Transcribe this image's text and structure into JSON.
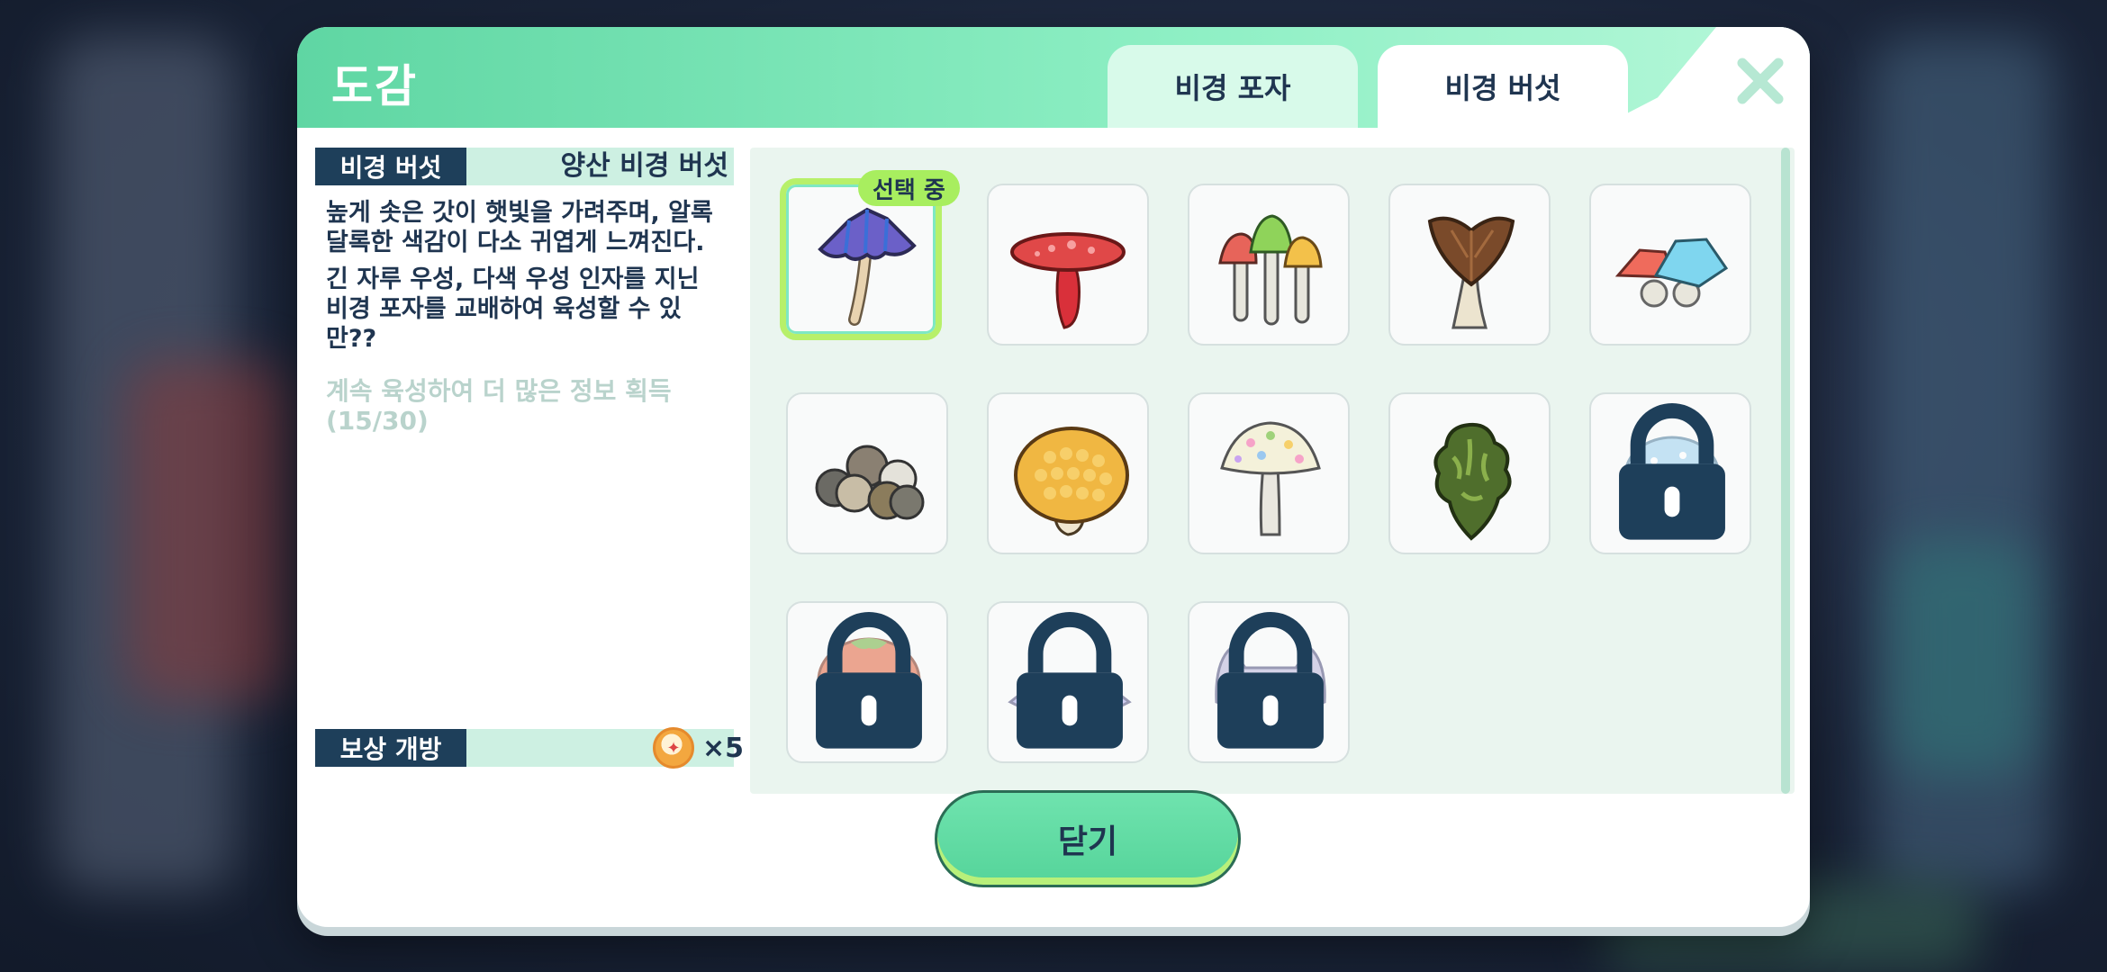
{
  "dialog": {
    "title": "도감",
    "tabs": [
      {
        "label": "비경 포자",
        "active": false
      },
      {
        "label": "비경 버섯",
        "active": true
      }
    ],
    "close_icon": "close-icon"
  },
  "info": {
    "category_tag": "비경 버섯",
    "item_name": "양산 비경 버섯",
    "description_1": "높게 솟은 갓이 햇빛을 가려주며, 알록\n달록한 색감이 다소 귀엽게 느껴진다.",
    "description_2": "긴 자루 우성, 다색 우성 인자를 지닌\n 비경 포자를 교배하여 육성할 수 있\n만??",
    "hint": "계속 육성하여 더 많은 정보 획득\n(15/30)",
    "reward_tag": "보상 개방",
    "reward_count": "×5",
    "reward_icon": "coin-icon"
  },
  "grid": {
    "selected_badge": "선택 중",
    "items": [
      {
        "icon": "purple-umbrella-mushroom",
        "locked": false,
        "selected": true
      },
      {
        "icon": "red-spotted-mushroom",
        "locked": false
      },
      {
        "icon": "tricolor-mushroom-cluster",
        "locked": false
      },
      {
        "icon": "brown-leaf-mushroom",
        "locked": false
      },
      {
        "icon": "crystal-mushroom",
        "locked": false
      },
      {
        "icon": "gray-mushroom-cluster",
        "locked": false
      },
      {
        "icon": "golden-honeycomb-mushroom",
        "locked": false
      },
      {
        "icon": "polka-dot-mushroom",
        "locked": false
      },
      {
        "icon": "green-coral-mushroom",
        "locked": false
      },
      {
        "icon": "frost-mushroom",
        "locked": true
      },
      {
        "icon": "tomato-mushroom",
        "locked": true
      },
      {
        "icon": "crystal-flat-mushroom",
        "locked": true
      },
      {
        "icon": "cat-ear-mushroom",
        "locked": true
      }
    ]
  },
  "footer": {
    "close_label": "닫기"
  },
  "colors": {
    "accent": "#6fe3ae",
    "dark_text": "#1f3550",
    "selected_border": "#b7f06a"
  }
}
